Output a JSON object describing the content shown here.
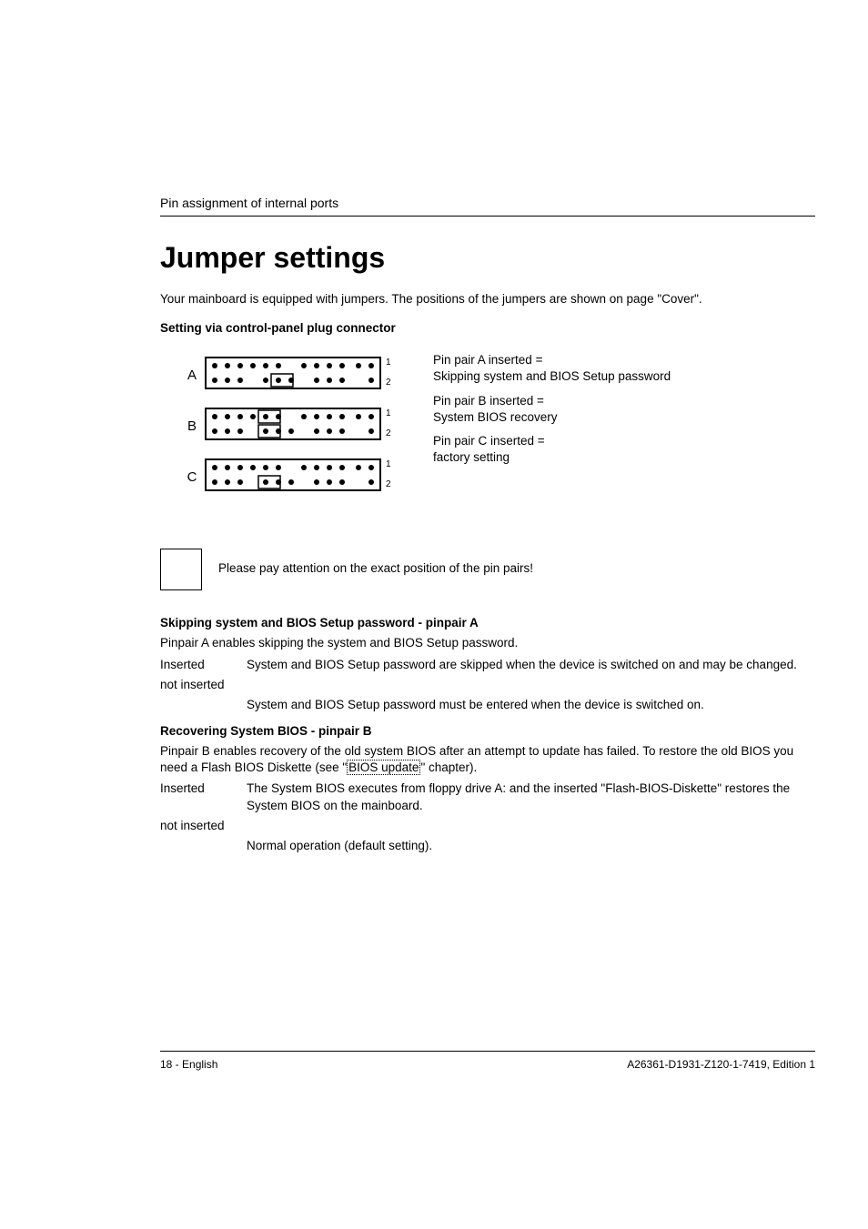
{
  "running_head": "Pin assignment of internal ports",
  "title": "Jumper settings",
  "intro_line": "Your mainboard is equipped with jumpers. The positions of the jumpers are shown on page \"Cover\".",
  "setting_header": "Setting via control-panel plug connector",
  "diagram": {
    "row_labels": [
      "A",
      "B",
      "C"
    ],
    "pin_labels": [
      "1",
      "2"
    ]
  },
  "right_desc": {
    "a1": "Pin pair A inserted =",
    "a2": "Skipping system and BIOS Setup password",
    "b1": "Pin pair B inserted =",
    "b2": "System BIOS recovery",
    "c1": "Pin pair C inserted =",
    "c2": "factory setting"
  },
  "note": "Please pay attention on the exact position of the pin pairs!",
  "section_a": {
    "heading": "Skipping system and BIOS Setup password - pinpair A",
    "para": "Pinpair A enables skipping the system and BIOS Setup password.",
    "inserted_label": "Inserted",
    "inserted_text": "System and BIOS Setup password are skipped when the device is switched on and may be changed.",
    "not_inserted_label": "not inserted",
    "not_inserted_text": "System and BIOS Setup password must be entered when the device is switched on."
  },
  "section_b": {
    "heading": "Recovering System BIOS - pinpair B",
    "para_prefix": "Pinpair B enables recovery of the old system BIOS after an attempt to update has failed. To restore the old BIOS you need a Flash BIOS Diskette (see \"",
    "link_text": "BIOS update",
    "para_suffix": "\" chapter).",
    "inserted_label": "Inserted",
    "inserted_text": "The System BIOS executes from floppy drive A: and the inserted \"Flash-BIOS-Diskette\" restores the System BIOS on the mainboard.",
    "not_inserted_label": "not inserted",
    "not_inserted_text": "Normal operation (default setting)."
  },
  "footer": {
    "left": "18 - English",
    "right": "A26361-D1931-Z120-1-7419, Edition 1"
  }
}
